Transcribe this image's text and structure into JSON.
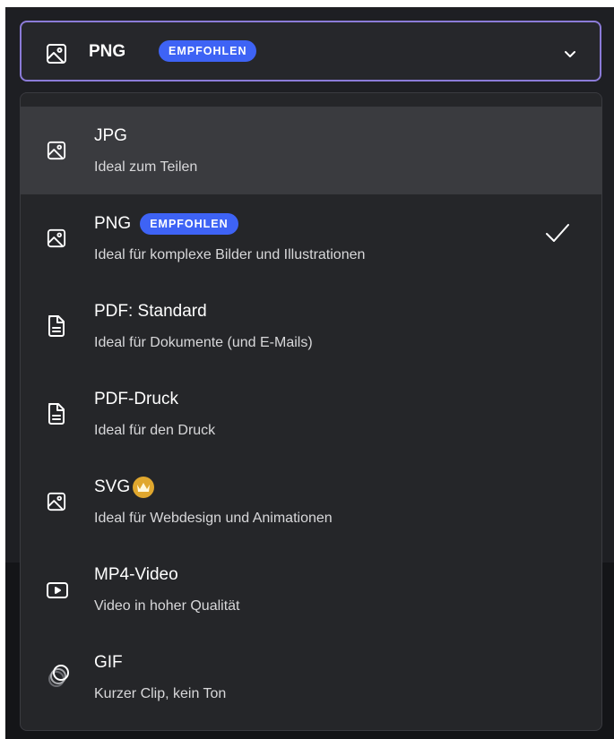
{
  "select": {
    "selected_label": "PNG",
    "selected_badge": "EMPFOHLEN",
    "icon": "image-icon",
    "open_icon": "chevron-down-icon"
  },
  "options": [
    {
      "title": "JPG",
      "desc": "Ideal zum Teilen",
      "icon": "image-icon",
      "hovered": true
    },
    {
      "title": "PNG",
      "badge": "EMPFOHLEN",
      "desc": "Ideal für komplexe Bilder und Illustrationen",
      "icon": "image-icon",
      "selected": true
    },
    {
      "title": "PDF: Standard",
      "desc": "Ideal für Dokumente (und E-Mails)",
      "icon": "document-icon"
    },
    {
      "title": "PDF-Druck",
      "desc": "Ideal für den Druck",
      "icon": "document-icon"
    },
    {
      "title": "SVG",
      "desc": "Ideal für Webdesign und Animationen",
      "icon": "image-icon",
      "premium": true
    },
    {
      "title": "MP4-Video",
      "desc": "Video in hoher Qualität",
      "icon": "video-icon"
    },
    {
      "title": "GIF",
      "desc": "Kurzer Clip, kein Ton",
      "icon": "gif-icon"
    }
  ],
  "colors": {
    "background": "#1e1f23",
    "dropdown": "#252629",
    "hover": "#3a3b3f",
    "accent_border": "#8b7bd8",
    "badge": "#3e63f5",
    "premium": "#e0a72e"
  }
}
